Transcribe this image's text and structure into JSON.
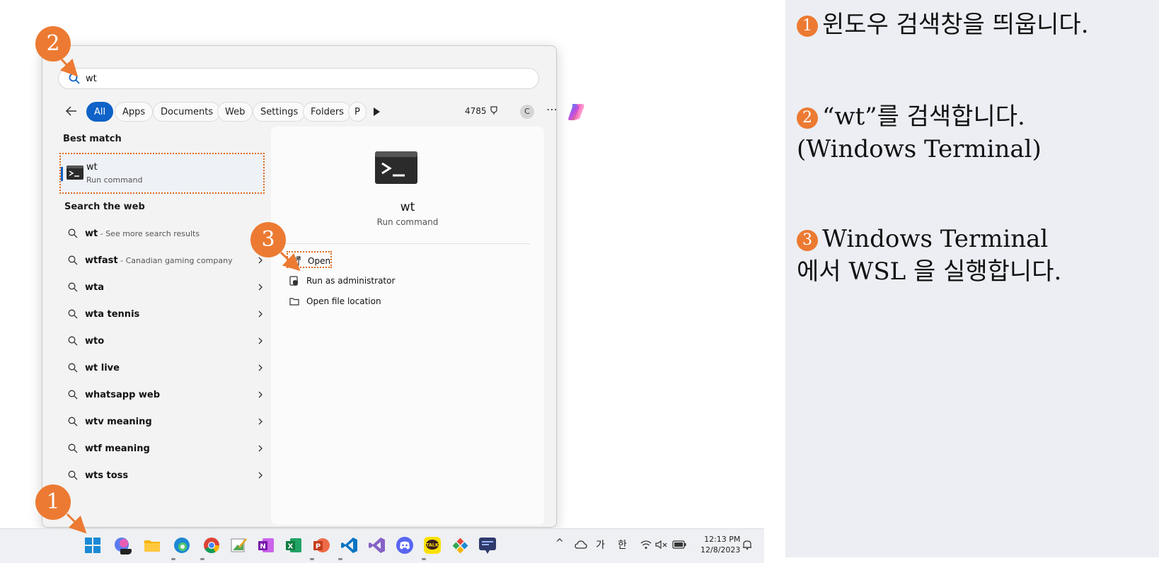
{
  "search": {
    "query": "wt"
  },
  "filters": {
    "chips": [
      "All",
      "Apps",
      "Documents",
      "Web",
      "Settings",
      "Folders",
      "P"
    ],
    "points": "4785",
    "account_initial": "C",
    "more": "⋯"
  },
  "best_match": {
    "title": "Best match",
    "name": "wt",
    "sub": "Run command"
  },
  "web": {
    "title": "Search the web",
    "items": [
      {
        "bold": "wt",
        "desc": " - See more search results"
      },
      {
        "bold": "wtfast",
        "desc": " - Canadian gaming company"
      },
      {
        "bold": "wta",
        "desc": ""
      },
      {
        "bold": "wta tennis",
        "desc": ""
      },
      {
        "bold": "wto",
        "desc": ""
      },
      {
        "bold": "wt live",
        "desc": ""
      },
      {
        "bold": "whatsapp web",
        "desc": ""
      },
      {
        "bold": "wtv meaning",
        "desc": ""
      },
      {
        "bold": "wtf meaning",
        "desc": ""
      },
      {
        "bold": "wts toss",
        "desc": ""
      }
    ]
  },
  "detail": {
    "name": "wt",
    "sub": "Run command",
    "actions": [
      "Open",
      "Run as administrator",
      "Open file location"
    ]
  },
  "taskbar": {
    "icons": [
      "windows-start-icon",
      "copilot-pre-icon",
      "file-explorer-icon",
      "edge-icon",
      "chrome-icon",
      "paint-icon",
      "onenote-icon",
      "excel-icon",
      "powerpoint-icon",
      "vscode-icon",
      "visual-studio-icon",
      "discord-icon",
      "kakaotalk-icon",
      "tool-icon",
      "screen-app-icon"
    ],
    "tray": {
      "chevron": "^",
      "ime1": "가",
      "ime2": "한"
    },
    "time": "12:13 PM",
    "date": "12/8/2023",
    "kakao_label": "TALK"
  },
  "badges": [
    "1",
    "2",
    "3"
  ],
  "steps": [
    {
      "num": "1",
      "lines": [
        "윈도우 검색창을 띄웁니다."
      ]
    },
    {
      "num": "2",
      "lines": [
        "“wt”를 검색합니다.",
        "(Windows Terminal)"
      ]
    },
    {
      "num": "3",
      "lines": [
        "Windows Terminal",
        "에서 WSL 을 실행합니다."
      ]
    }
  ],
  "colors": {
    "accent": "#ec7a32",
    "highlight_border": "#e06a1b",
    "active_chip": "#0f62c7"
  }
}
